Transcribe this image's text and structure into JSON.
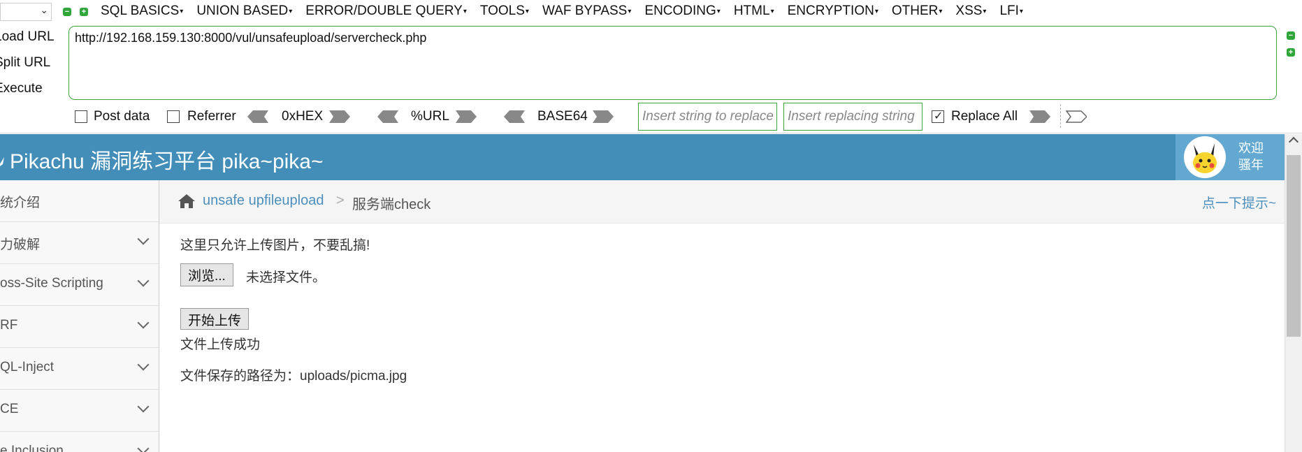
{
  "hackbar": {
    "menu": [
      "SQL BASICS",
      "UNION BASED",
      "ERROR/DOUBLE QUERY",
      "TOOLS",
      "WAF BYPASS",
      "ENCODING",
      "HTML",
      "ENCRYPTION",
      "OTHER",
      "XSS",
      "LFI"
    ],
    "load_url": "Load URL",
    "split_url": "Split URL",
    "execute": "Execute",
    "url": "http://192.168.159.130:8000/vul/unsafeupload/servercheck.php",
    "post_data": "Post data",
    "referrer": "Referrer",
    "hex": "0xHEX",
    "url_enc": "%URL",
    "base64": "BASE64",
    "replace_placeholder": "Insert string to replace",
    "replacing_placeholder": "Insert replacing string",
    "replace_all": "Replace All"
  },
  "header": {
    "title": "Pikachu 漏洞练习平台 pika~pika~",
    "welcome_line1": "欢迎",
    "welcome_line2": "骚年"
  },
  "sidebar": {
    "items": [
      "统介绍",
      "力破解",
      "oss-Site Scripting",
      "RF",
      "QL-Inject",
      "CE",
      "e Inclusion"
    ]
  },
  "breadcrumb": {
    "link": "unsafe upfileupload",
    "separator": ">",
    "current": "服务端check",
    "hint": "点一下提示~"
  },
  "content": {
    "notice": "这里只允许上传图片，不要乱搞!",
    "browse_button": "浏览...",
    "no_file": "未选择文件。",
    "upload_button": "开始上传",
    "success": "文件上传成功",
    "saved_path": "文件保存的路径为：uploads/picma.jpg"
  }
}
